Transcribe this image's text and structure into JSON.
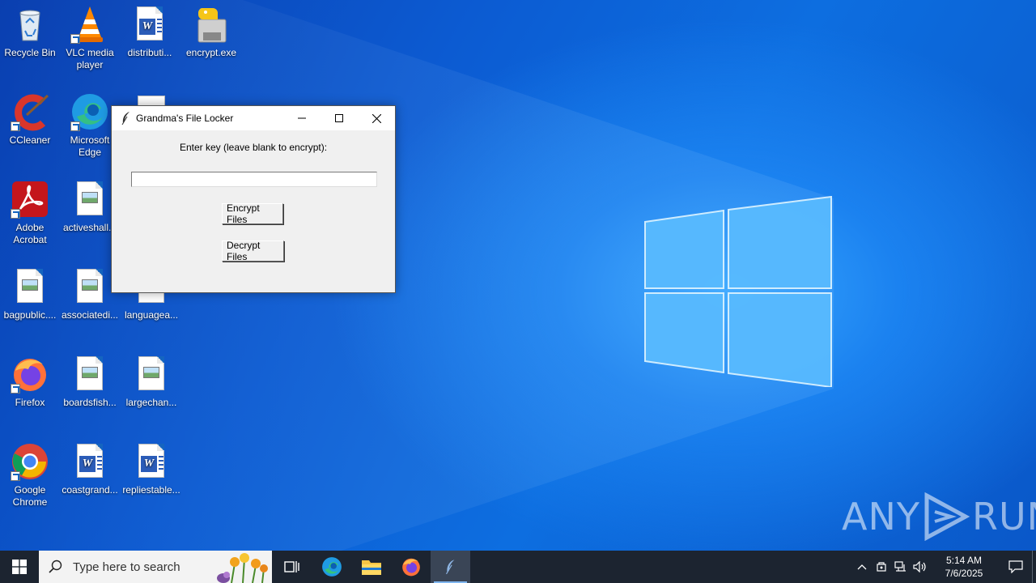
{
  "desktop": {
    "icons": [
      {
        "label": "Recycle Bin",
        "icon": "recycle-bin-icon"
      },
      {
        "label": "VLC media player",
        "icon": "vlc-icon"
      },
      {
        "label": "distributi...",
        "icon": "word-doc-icon"
      },
      {
        "label": "encrypt.exe",
        "icon": "python-exe-icon"
      },
      {
        "label": "CCleaner",
        "icon": "ccleaner-icon"
      },
      {
        "label": "Microsoft Edge",
        "icon": "edge-icon"
      },
      {
        "label": "Adobe Acrobat",
        "icon": "acrobat-icon"
      },
      {
        "label": "activeshall...",
        "icon": "image-file-icon"
      },
      {
        "label": "bagpublic....",
        "icon": "image-file-icon"
      },
      {
        "label": "associatedi...",
        "icon": "image-file-icon"
      },
      {
        "label": "languagea...",
        "icon": "image-file-icon"
      },
      {
        "label": "Firefox",
        "icon": "firefox-icon"
      },
      {
        "label": "boardsfish...",
        "icon": "image-file-icon"
      },
      {
        "label": "largechan...",
        "icon": "image-file-icon"
      },
      {
        "label": "Google Chrome",
        "icon": "chrome-icon"
      },
      {
        "label": "coastgrand...",
        "icon": "word-doc-icon"
      },
      {
        "label": "repliestable...",
        "icon": "word-doc-icon"
      }
    ]
  },
  "window": {
    "title": "Grandma's File Locker",
    "prompt": "Enter key (leave blank to encrypt):",
    "key_value": "",
    "encrypt_label": "Encrypt Files",
    "decrypt_label": "Decrypt Files"
  },
  "watermark": {
    "left": "ANY",
    "right": "RUN"
  },
  "taskbar": {
    "search_placeholder": "Type here to search",
    "time": "5:14 AM",
    "date": "7/6/2025"
  },
  "colors": {
    "taskbar_bg": "#1c2430",
    "desktop_blue": "#0c5bd2",
    "window_bg": "#f0f0f0"
  }
}
